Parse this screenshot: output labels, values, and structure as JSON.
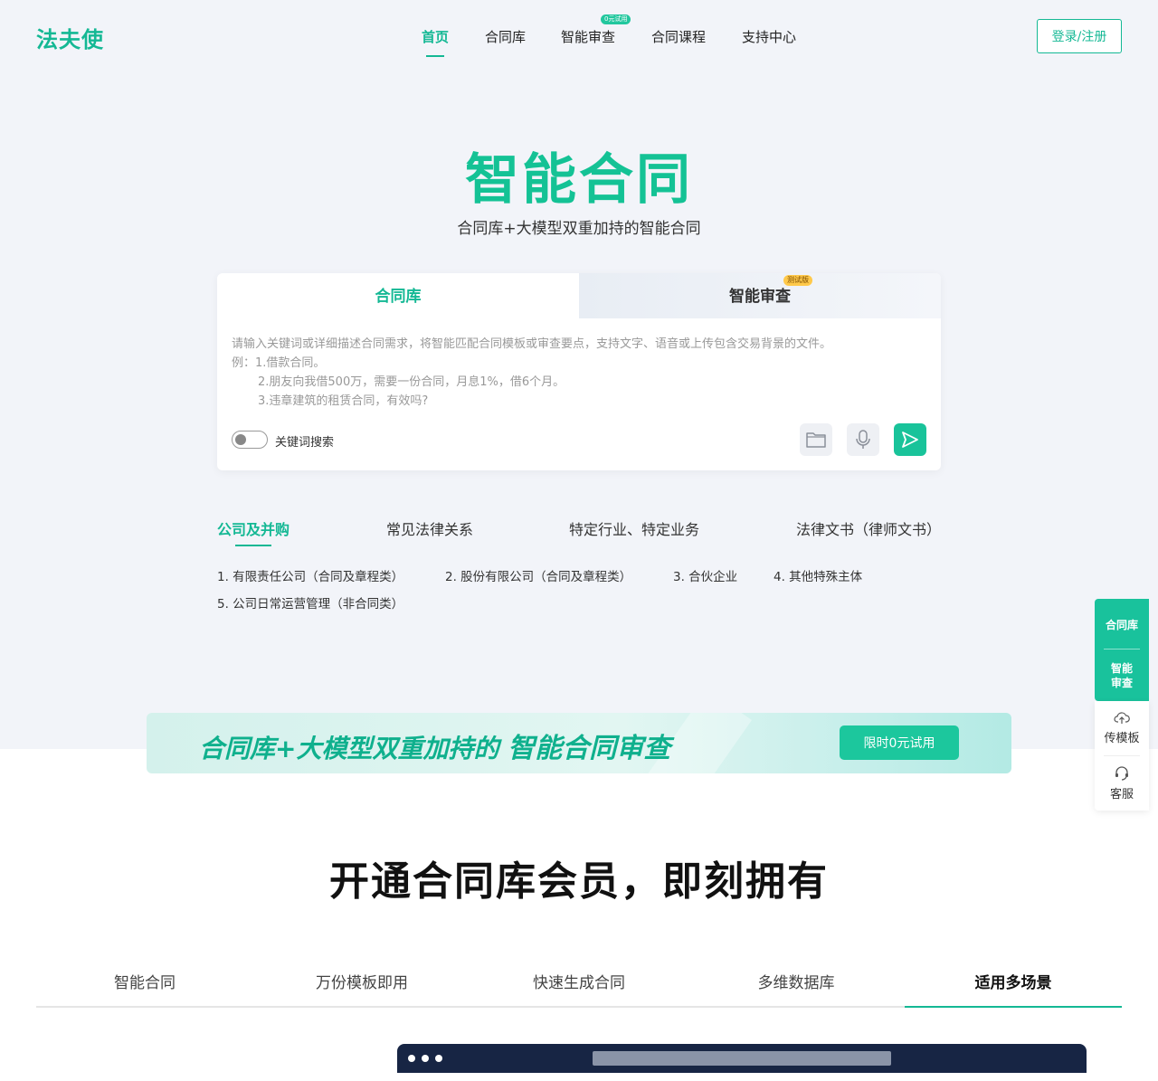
{
  "header": {
    "logo": "法夫使",
    "nav": [
      {
        "label": "首页",
        "active": true
      },
      {
        "label": "合同库",
        "active": false
      },
      {
        "label": "智能审查",
        "active": false,
        "badge": "0元试用"
      },
      {
        "label": "合同课程",
        "active": false
      },
      {
        "label": "支持中心",
        "active": false
      }
    ],
    "login_label": "登录/注册"
  },
  "hero": {
    "title": "智能合同",
    "subtitle": "合同库+大模型双重加持的智能合同"
  },
  "search_card": {
    "tabs": [
      {
        "label": "合同库",
        "active": true
      },
      {
        "label": "智能审查",
        "active": false,
        "badge": "测试版"
      }
    ],
    "hint_lines": [
      "请输入关键词或详细描述合同需求，将智能匹配合同模板或审查要点，支持文字、语音或上传包含交易背景的文件。",
      "例：1.借款合同。",
      "2.朋友向我借500万，需要一份合同，月息1%，借6个月。",
      "3.违章建筑的租赁合同，有效吗?"
    ],
    "toggle_label": "关键词搜索",
    "toggle_on": false,
    "icons": [
      "folder-icon",
      "microphone-icon",
      "send-icon"
    ]
  },
  "categories": {
    "tabs": [
      "公司及并购",
      "常见法律关系",
      "特定行业、特定业务",
      "法律文书（律师文书）"
    ],
    "active_index": 0,
    "items": [
      "1. 有限责任公司（合同及章程类）",
      "2. 股份有限公司（合同及章程类）",
      "3. 合伙企业",
      "4. 其他特殊主体",
      "5. 公司日常运营管理（非合同类）"
    ]
  },
  "banner": {
    "text_prefix": "合同库+大模型双重加持的",
    "text_strong": "智能合同审查",
    "button": "限时0元试用"
  },
  "float_bar": {
    "item1": "合同库",
    "item2_line1": "智能",
    "item2_line2": "审查",
    "upload_label": "传模板",
    "service_label": "客服",
    "upload_icon": "cloud-upload-icon",
    "service_icon": "headset-icon"
  },
  "members": {
    "title": "开通合同库会员，即刻拥有",
    "tabs": [
      "智能合同",
      "万份模板即用",
      "快速生成合同",
      "多维数据库",
      "适用多场景"
    ],
    "active_index": 4
  },
  "colors": {
    "brand": "#14b894",
    "accent_beta": "#ffc94a",
    "mock_dark": "#172544"
  }
}
